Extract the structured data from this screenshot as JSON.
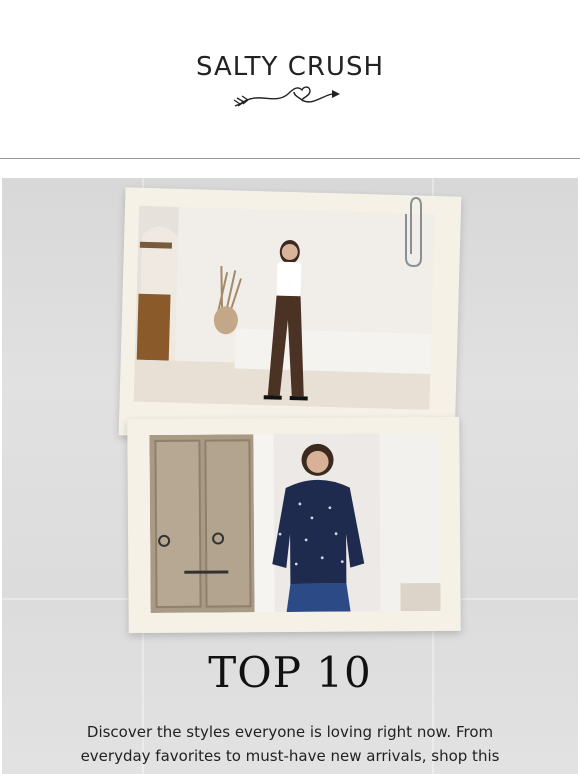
{
  "brand": {
    "name": "SALTY CRUSH",
    "logo_icon": "arrow-heart-icon"
  },
  "hero": {
    "title": "TOP 10",
    "description": "Discover the styles everyone is loving right now. From everyday favorites to must-have new arrivals, shop this"
  },
  "photos": [
    {
      "name": "photo-white-tank-brown-flares"
    },
    {
      "name": "photo-navy-studded-sweater"
    }
  ],
  "colors": {
    "background": "#ffffff",
    "hero_bg": "#dcdcdc",
    "frame": "#f5f1e6",
    "text": "#111111"
  }
}
